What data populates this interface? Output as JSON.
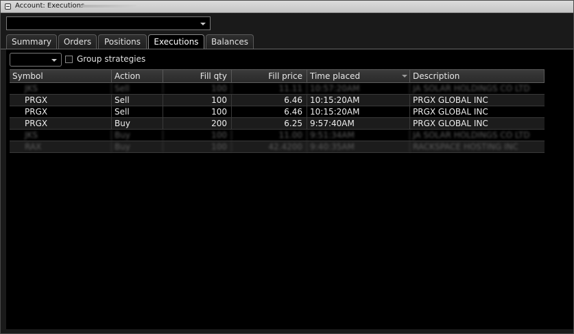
{
  "window": {
    "title": "Account: Executions"
  },
  "tabs": [
    {
      "label": "Summary",
      "active": false
    },
    {
      "label": "Orders",
      "active": false
    },
    {
      "label": "Positions",
      "active": false
    },
    {
      "label": "Executions",
      "active": true
    },
    {
      "label": "Balances",
      "active": false
    }
  ],
  "filters": {
    "group_strategies_label": "Group strategies",
    "group_strategies_checked": false
  },
  "table": {
    "columns": [
      "Symbol",
      "Action",
      "Fill qty",
      "Fill price",
      "Time placed",
      "Description"
    ],
    "sorted_column": "Time placed",
    "rows": [
      {
        "symbol": "JKS",
        "action": "Sell",
        "qty": "100",
        "price": "11.11",
        "time": "10:57:20AM",
        "desc": "JA SOLAR HOLDINGS CO LTD",
        "redacted": true
      },
      {
        "symbol": "PRGX",
        "action": "Sell",
        "qty": "100",
        "price": "6.46",
        "time": "10:15:20AM",
        "desc": "PRGX GLOBAL INC",
        "redacted": false
      },
      {
        "symbol": "PRGX",
        "action": "Sell",
        "qty": "100",
        "price": "6.46",
        "time": "10:15:20AM",
        "desc": "PRGX GLOBAL INC",
        "redacted": false
      },
      {
        "symbol": "PRGX",
        "action": "Buy",
        "qty": "200",
        "price": "6.25",
        "time": "9:57:40AM",
        "desc": "PRGX GLOBAL INC",
        "redacted": false
      },
      {
        "symbol": "JKS",
        "action": "Buy",
        "qty": "100",
        "price": "11.00",
        "time": "9:51:34AM",
        "desc": "JA SOLAR HOLDINGS CO LTD",
        "redacted": true
      },
      {
        "symbol": "RAX",
        "action": "Buy",
        "qty": "100",
        "price": "42.4200",
        "time": "9:40:35AM",
        "desc": "RACKSPACE HOSTING INC",
        "redacted": true
      }
    ]
  },
  "colors": {
    "background": "#000000",
    "panel": "#1a1a1a",
    "text": "#e6e6e6"
  }
}
